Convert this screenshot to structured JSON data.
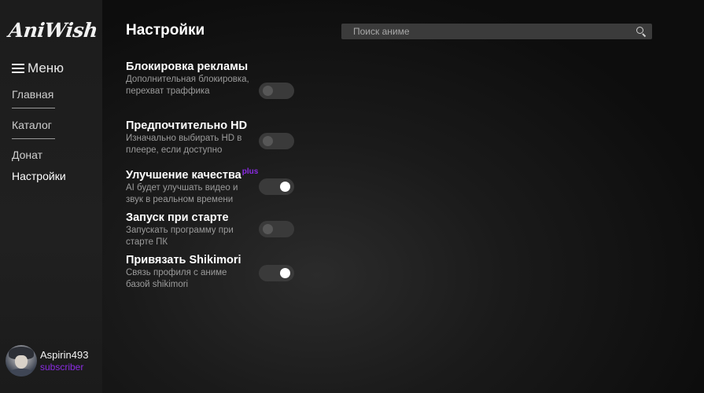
{
  "app": {
    "logo": "AniWish"
  },
  "sidebar": {
    "menu_label": "Меню",
    "items": [
      {
        "label": "Главная"
      },
      {
        "label": "Каталог"
      },
      {
        "label": "Донат"
      },
      {
        "label": "Настройки"
      }
    ]
  },
  "user": {
    "name": "Aspirin493",
    "status": "subscriber"
  },
  "header": {
    "title": "Настройки",
    "search_placeholder": "Поиск аниме"
  },
  "settings": [
    {
      "title": "Блокировка рекламы",
      "badge": "",
      "description": "Дополнительная блокировка, перехват траффика",
      "enabled": false
    },
    {
      "title": "Предпочтительно HD",
      "badge": "",
      "description": "Изначально выбирать HD в плеере, если доступно",
      "enabled": false
    },
    {
      "title": "Улучшение качества",
      "badge": "plus",
      "description": "AI будет улучшать видео и звук в реальном времени",
      "enabled": true
    },
    {
      "title": "Запуск при старте",
      "badge": "",
      "description": "Запускать программу при старте ПК",
      "enabled": false
    },
    {
      "title": "Привязать Shikimori",
      "badge": "",
      "description": "Связь профиля с аниме базой shikimori",
      "enabled": true
    }
  ],
  "colors": {
    "accent": "#8a2be2",
    "toggle_on_knob": "#ffffff",
    "toggle_off_knob": "#575757"
  },
  "icons": {
    "search": "search-icon",
    "menu": "hamburger-icon"
  }
}
